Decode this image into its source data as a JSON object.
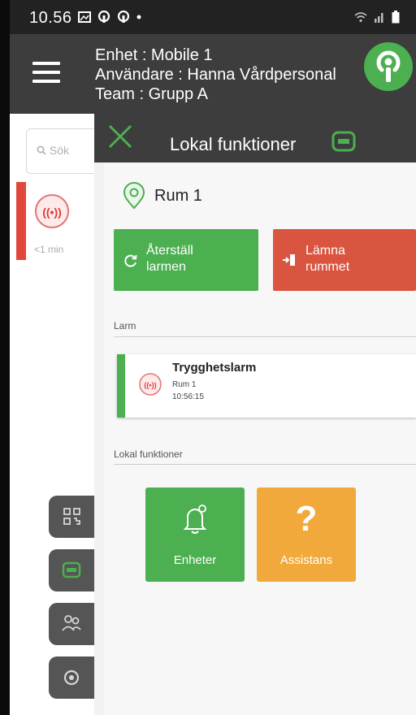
{
  "status_bar": {
    "time": "10.56"
  },
  "header": {
    "line1": "Enhet : Mobile 1",
    "line2": "Användare : Hanna Vårdpersonal",
    "line3": "Team : Grupp A"
  },
  "background": {
    "search_placeholder": "Sök",
    "alarm_age": "<1 min"
  },
  "side_buttons": [
    "qr-code-icon",
    "device-icon",
    "people-icon",
    "settings-icon"
  ],
  "panel": {
    "title": "Lokal funktioner",
    "room": "Rum 1",
    "reset_button": {
      "line1": "Återställ",
      "line2": "larmen"
    },
    "leave_button": {
      "line1": "Lämna",
      "line2": "rummet"
    },
    "alarm_section": "Larm",
    "alarm": {
      "name": "Trygghetslarm",
      "room": "Rum 1",
      "time": "10:56:15"
    },
    "functions_section": "Lokal funktioner",
    "tiles": {
      "enheter": "Enheter",
      "assistans": "Assistans",
      "assistans_symbol": "?"
    }
  },
  "colors": {
    "green": "#4caf50",
    "red": "#d9553f",
    "orange": "#f2a93b",
    "header_bg": "#3d3d3d"
  }
}
